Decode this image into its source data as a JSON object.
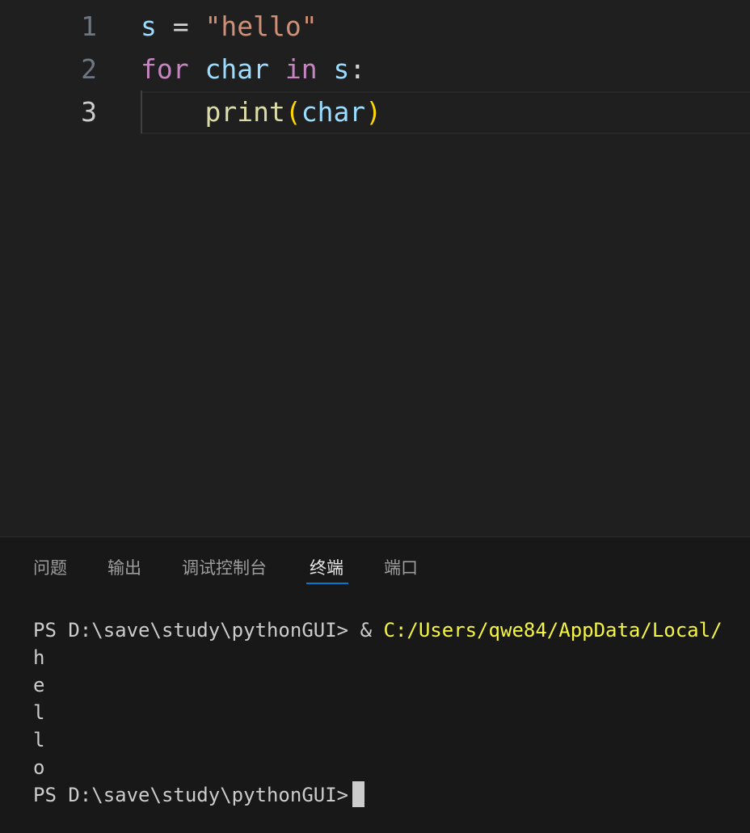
{
  "editor": {
    "lines": [
      {
        "number": "1",
        "tokens": [
          "s",
          " = ",
          "\"hello\""
        ]
      },
      {
        "number": "2",
        "tokens": [
          "for",
          " ",
          "char",
          " ",
          "in",
          " ",
          "s",
          ":"
        ]
      },
      {
        "number": "3",
        "tokens": [
          "    ",
          "print",
          "(",
          "char",
          ")"
        ]
      }
    ]
  },
  "panel": {
    "tabs": [
      {
        "label": "问题"
      },
      {
        "label": "输出"
      },
      {
        "label": "调试控制台"
      },
      {
        "label": "终端",
        "active": true
      },
      {
        "label": "端口"
      }
    ]
  },
  "terminal": {
    "prompt": "PS D:\\save\\study\\pythonGUI>",
    "command_op": " & ",
    "command_path": "C:/Users/qwe84/AppData/Local/",
    "output": [
      "h",
      "e",
      "l",
      "l",
      "o"
    ],
    "final_prompt": "PS D:\\save\\study\\pythonGUI>"
  },
  "colors": {
    "keyword": "#c586c0",
    "variable": "#9cdcfe",
    "string": "#ce9178",
    "function": "#dcdcaa",
    "bracket": "#ffd700",
    "terminal_path": "#f5f543",
    "tab_accent": "#0078d4"
  }
}
